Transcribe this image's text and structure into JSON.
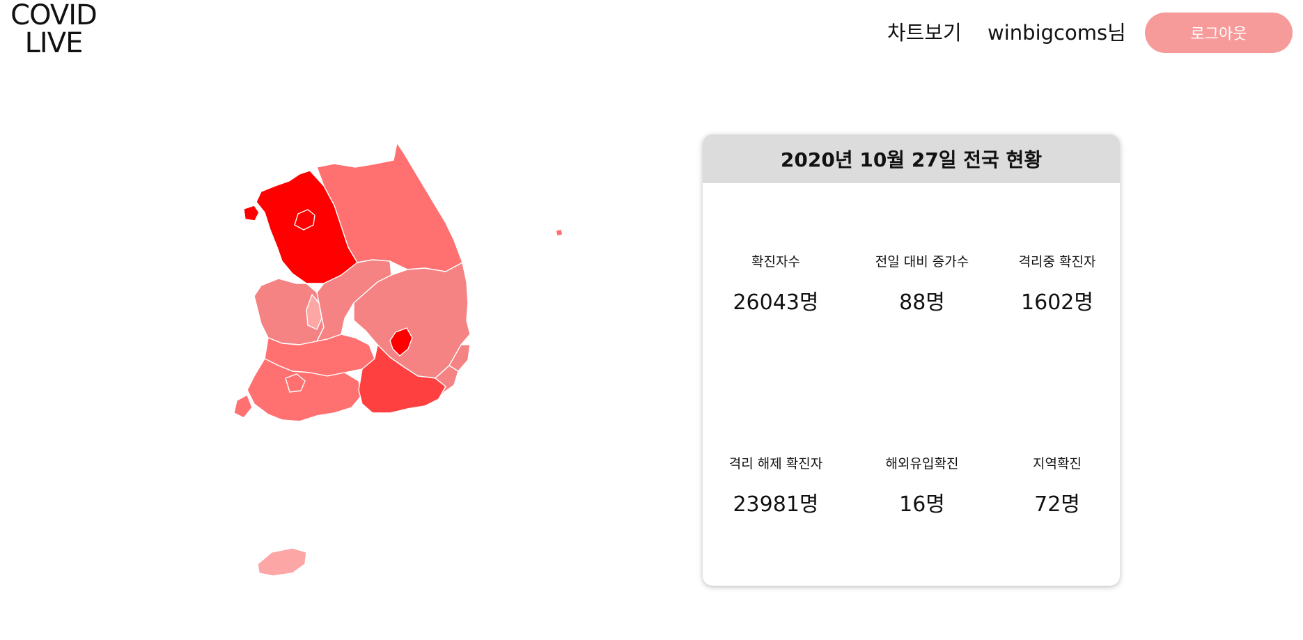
{
  "header": {
    "logo_line1": "COVID",
    "logo_line2": "LIVE",
    "chart_link": "차트보기",
    "user_greeting": "winbigcoms님",
    "logout_label": "로그아웃"
  },
  "colors": {
    "logout_button": "#f79a9a",
    "card_header": "#dcdcdc",
    "level_highest": "#ff0000",
    "level_high": "#ff4040",
    "level_mid": "#ff7171",
    "level_low": "#f58383",
    "level_lowest": "#fca6a6"
  },
  "summary": {
    "title": "2020년 10월 27일 전국 현황",
    "stats": [
      {
        "label": "확진자수",
        "value": "26043명"
      },
      {
        "label": "전일 대비 증가수",
        "value": "88명"
      },
      {
        "label": "격리중 확진자",
        "value": "1602명"
      },
      {
        "label": "격리 해제 확진자",
        "value": "23981명"
      },
      {
        "label": "해외유입확진",
        "value": "16명"
      },
      {
        "label": "지역확진",
        "value": "72명"
      }
    ]
  }
}
